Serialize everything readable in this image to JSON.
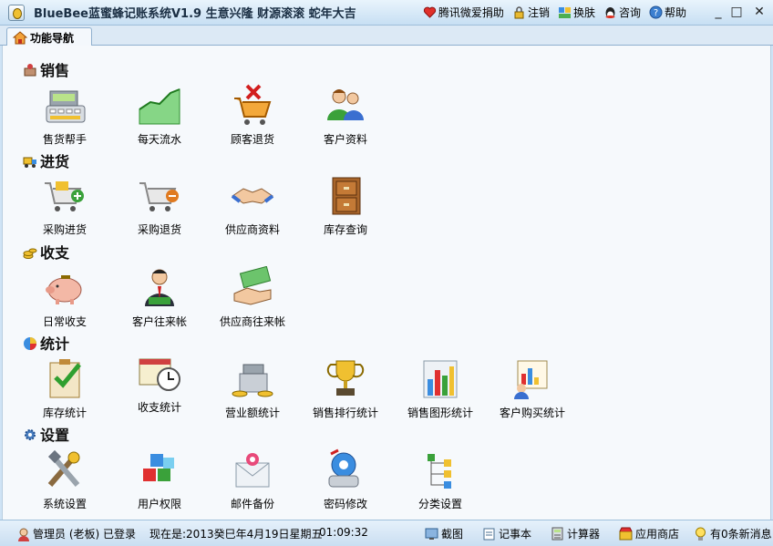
{
  "app": {
    "title": "BlueBee蓝蜜蜂记账系统V1.9 生意兴隆  财源滚滚  蛇年大吉"
  },
  "titlebar_menu": [
    {
      "label": "腾讯微爱捐助",
      "icon": "heart-icon"
    },
    {
      "label": "注销",
      "icon": "lock-icon"
    },
    {
      "label": "换肤",
      "icon": "skin-icon"
    },
    {
      "label": "咨询",
      "icon": "qq-icon"
    },
    {
      "label": "帮助",
      "icon": "help-icon"
    }
  ],
  "window_controls": {
    "minimize": "_",
    "maximize": "□",
    "close": "✕"
  },
  "tabs": [
    {
      "label": "功能导航",
      "icon": "home-icon"
    }
  ],
  "sections": [
    {
      "title": "销售",
      "icon": "sales-icon",
      "items": [
        {
          "label": "售货帮手",
          "icon": "cash-register-icon"
        },
        {
          "label": "每天流水",
          "icon": "growth-chart-icon"
        },
        {
          "label": "顾客退货",
          "icon": "cart-remove-icon"
        },
        {
          "label": "客户资料",
          "icon": "customers-icon"
        }
      ]
    },
    {
      "title": "进货",
      "icon": "truck-icon",
      "items": [
        {
          "label": "采购进货",
          "icon": "cart-add-icon"
        },
        {
          "label": "采购退货",
          "icon": "cart-minus-icon"
        },
        {
          "label": "供应商资料",
          "icon": "handshake-icon"
        },
        {
          "label": "库存查询",
          "icon": "file-cabinet-icon"
        }
      ]
    },
    {
      "title": "收支",
      "icon": "coins-icon",
      "items": [
        {
          "label": "日常收支",
          "icon": "piggy-bank-icon"
        },
        {
          "label": "客户往来帐",
          "icon": "businessman-icon"
        },
        {
          "label": "供应商往来帐",
          "icon": "money-hand-icon"
        }
      ]
    },
    {
      "title": "统计",
      "icon": "pie-icon",
      "items": [
        {
          "label": "库存统计",
          "icon": "checklist-icon"
        },
        {
          "label": "收支统计",
          "icon": "calendar-clock-icon"
        },
        {
          "label": "营业额统计",
          "icon": "register-coins-icon"
        },
        {
          "label": "销售排行统计",
          "icon": "trophy-icon"
        },
        {
          "label": "销售图形统计",
          "icon": "bar-chart-icon"
        },
        {
          "label": "客户购买统计",
          "icon": "customer-report-icon"
        }
      ]
    },
    {
      "title": "设置",
      "icon": "gear-icon",
      "items": [
        {
          "label": "系统设置",
          "icon": "tools-icon"
        },
        {
          "label": "用户权限",
          "icon": "blocks-icon"
        },
        {
          "label": "邮件备份",
          "icon": "mail-icon"
        },
        {
          "label": "密码修改",
          "icon": "key-lock-icon"
        },
        {
          "label": "分类设置",
          "icon": "tree-icon"
        }
      ]
    }
  ],
  "status": {
    "user": "管理员 (老板) 已登录",
    "now_label": "现在是:2013癸巳年4月19日星期五",
    "time": "01:09:32",
    "tools": [
      {
        "label": "截图",
        "icon": "screenshot-icon"
      },
      {
        "label": "记事本",
        "icon": "notepad-icon"
      },
      {
        "label": "计算器",
        "icon": "calculator-icon"
      },
      {
        "label": "应用商店",
        "icon": "store-icon"
      }
    ],
    "messages": "有0条新消息"
  }
}
